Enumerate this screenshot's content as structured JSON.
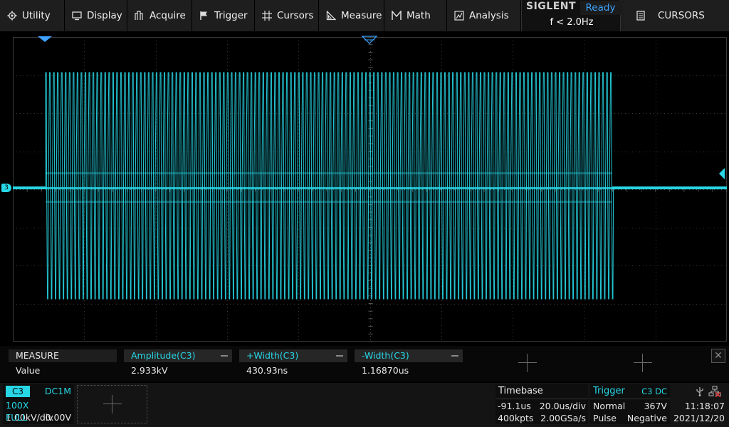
{
  "menu": {
    "utility": "Utility",
    "display": "Display",
    "acquire": "Acquire",
    "trigger": "Trigger",
    "cursors": "Cursors",
    "measure": "Measure",
    "math": "Math",
    "analysis": "Analysis"
  },
  "brand": {
    "name": "SIGLENT",
    "status": "Ready",
    "freq": "f < 2.0Hz"
  },
  "cursors_panel": {
    "label": "CURSORS"
  },
  "measure": {
    "title": "MEASURE",
    "row_label": "Value",
    "items": [
      {
        "name": "Amplitude(C3)",
        "value": "2.933kV"
      },
      {
        "name": "+Width(C3)",
        "value": "430.93ns"
      },
      {
        "name": "-Width(C3)",
        "value": "1.16870us"
      }
    ]
  },
  "channel": {
    "name": "C3",
    "coupling": "DC1M",
    "probe": "100X",
    "scale": "1.00kV/div",
    "bandwidth": "FULL",
    "offset": "0.00V"
  },
  "timebase": {
    "title": "Timebase",
    "delay": "-91.1us",
    "scale": "20.0us/div",
    "memory": "400kpts",
    "sample_rate": "2.00GSa/s"
  },
  "trigger": {
    "title": "Trigger",
    "source": "C3 DC",
    "mode": "Normal",
    "level": "367V",
    "type": "Pulse",
    "polarity": "Negative"
  },
  "clock": {
    "time": "11:18:07",
    "date": "2021/12/20"
  },
  "colors": {
    "trace": "#27d7e6",
    "accent": "#3da3ff",
    "grid": "#3a3a3a"
  },
  "waveform": {
    "channel_marker": "3"
  }
}
